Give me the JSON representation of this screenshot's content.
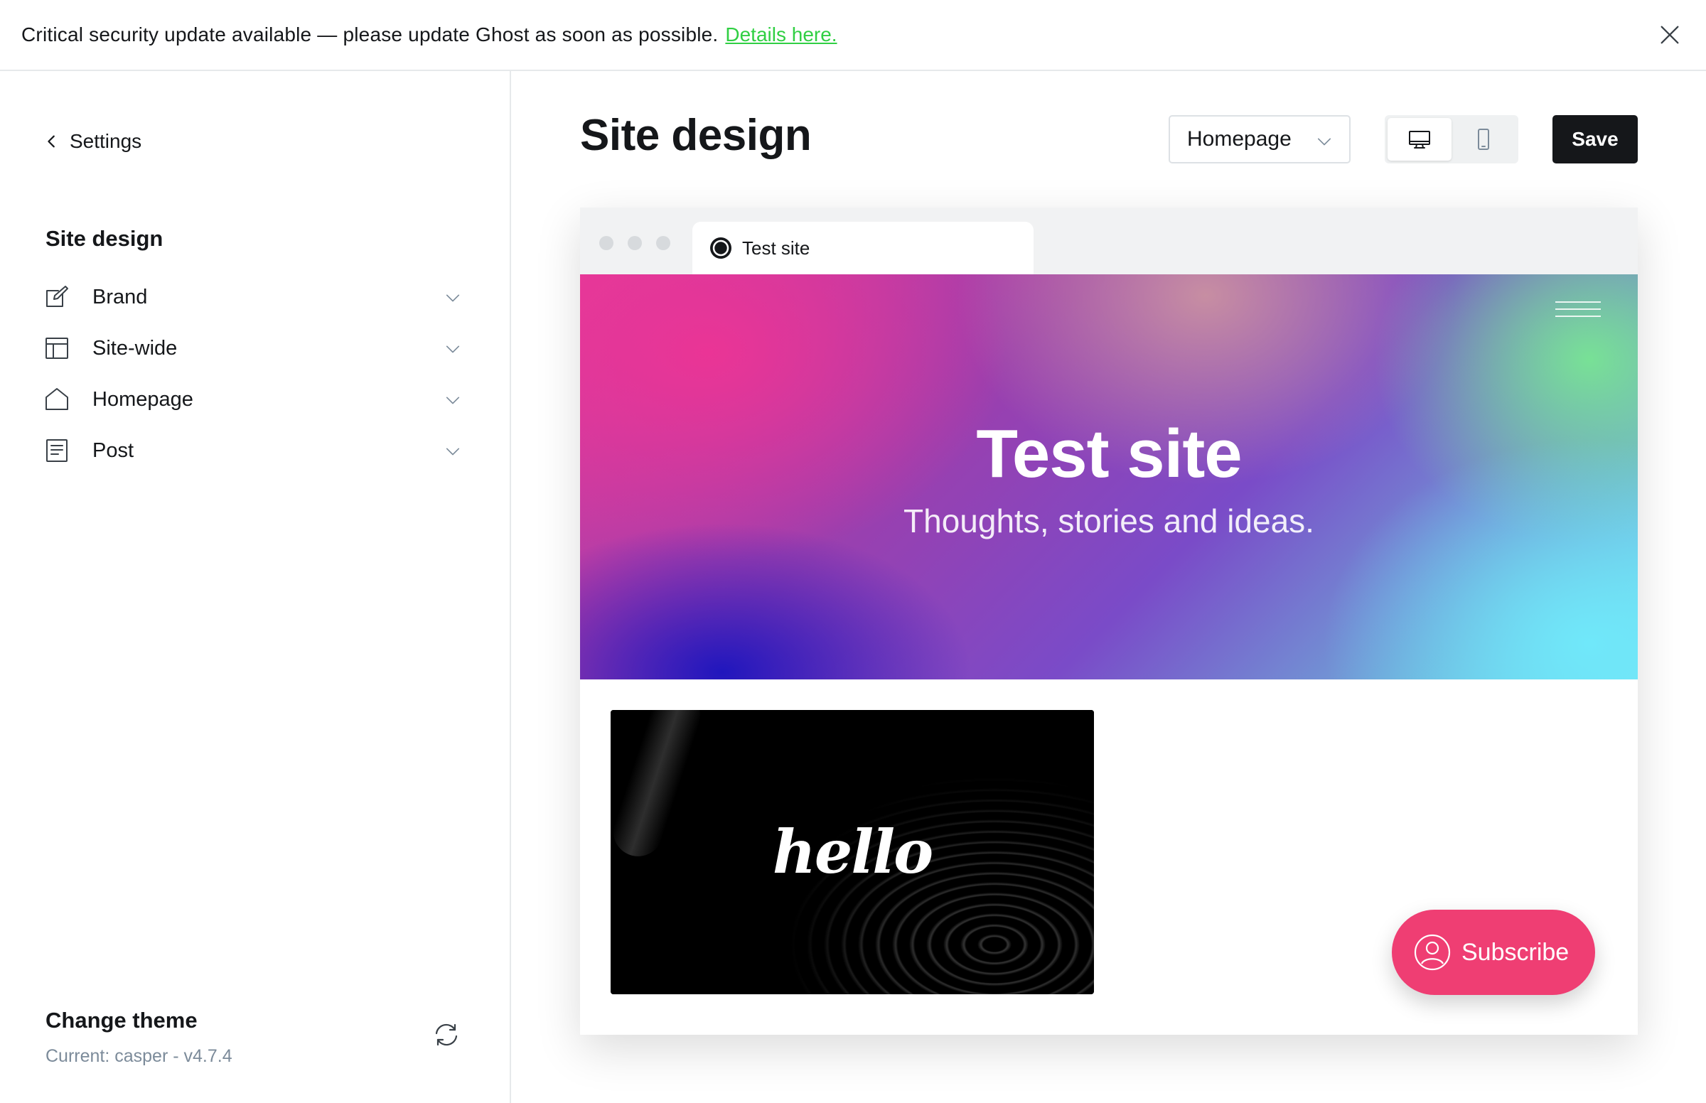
{
  "banner": {
    "text": "Critical security update available — please update Ghost as soon as possible.",
    "link": "Details here."
  },
  "sidebar": {
    "back_label": "Settings",
    "title": "Site design",
    "items": [
      {
        "label": "Brand",
        "icon": "brush-icon"
      },
      {
        "label": "Site-wide",
        "icon": "layout-icon"
      },
      {
        "label": "Homepage",
        "icon": "home-icon"
      },
      {
        "label": "Post",
        "icon": "document-icon"
      }
    ],
    "theme": {
      "title": "Change theme",
      "current": "Current: casper - v4.7.4"
    }
  },
  "header": {
    "title": "Site design",
    "page_select": "Homepage",
    "save_label": "Save"
  },
  "preview": {
    "tab_title": "Test site",
    "site_title": "Test site",
    "site_description": "Thoughts, stories and ideas.",
    "post_image_text": "hello",
    "subscribe_label": "Subscribe"
  },
  "colors": {
    "accent": "#ef3e73",
    "link": "#30cf43",
    "primary": "#15171a"
  }
}
